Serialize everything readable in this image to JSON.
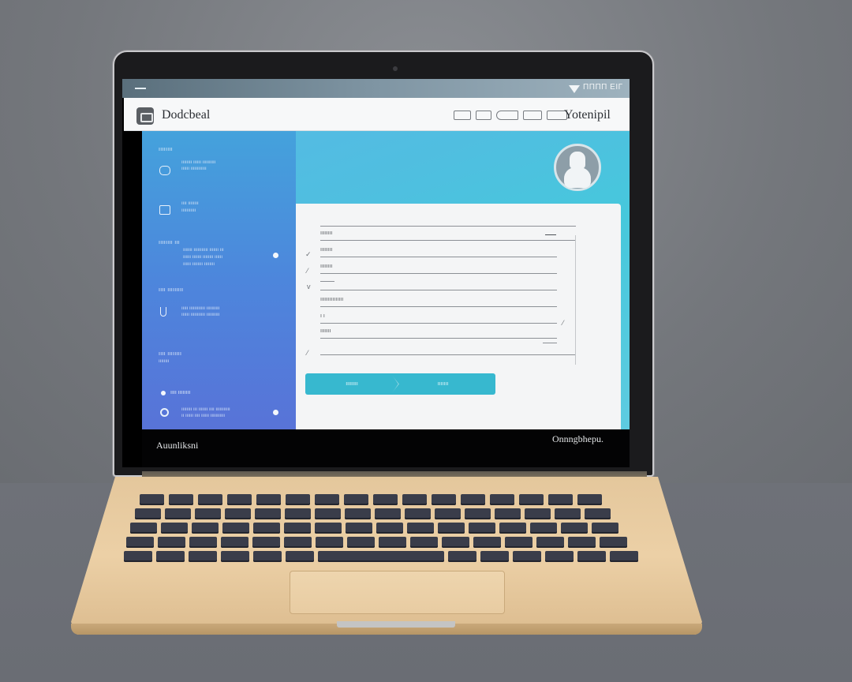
{
  "os_bar": {
    "status": "ΠΠΠΠ ΕΙΓ"
  },
  "header": {
    "title": "Dodcbeal",
    "user": "Yotenipil"
  },
  "sidebar": {
    "sections": [
      {
        "heading": "ıııııııı",
        "lines": [
          "ıııııııı ıııııı ıııııııııı",
          "ıııııı ıııııııııııı"
        ]
      },
      {
        "heading": "",
        "lines": [
          "ıııı ıııııııı",
          "ııııııııııı"
        ]
      },
      {
        "heading": "ıııııııı ııı",
        "lines": [
          "ııııııı ııııııııııı ııııııı ııı",
          "ıııııı ııııııı ıııııııı ıııııı",
          "ıııııı ıııııııı ıııııııı"
        ]
      },
      {
        "heading": "ıııı ııııııııı",
        "lines": [
          "ııııı ıııııııııııı ıııııııııı",
          "ıııııı ııııııııııı ıııııııııı"
        ]
      },
      {
        "heading": "ıııı ıııııııı",
        "lines": [
          "ıııııııı"
        ]
      },
      {
        "heading": "ıııı ıııııııı",
        "lines": []
      },
      {
        "heading": "",
        "lines": [
          "ıııııııı ııı ııııııı ıııı ııııııııııı",
          "ıı ıııııı ıııı ıııııı ııııııııııı"
        ]
      }
    ]
  },
  "form": {
    "fields": [
      {
        "label": "ıııııııı"
      },
      {
        "label": "ıııııııı"
      },
      {
        "label": "ıııııııı"
      },
      {
        "label": ""
      },
      {
        "label": "ııııııııııııııı"
      },
      {
        "label": "ı ı"
      },
      {
        "label": "ııııııı"
      },
      {
        "label": ""
      }
    ],
    "button_left": "ıııııııı",
    "button_right": "ııııııı"
  },
  "footer": {
    "left": "Auunliksni",
    "right": "Onnngbhepu."
  },
  "colors": {
    "accent": "#37b8cf",
    "sidebar_top": "#44a2dc",
    "sidebar_bottom": "#5873d8",
    "header_bg": "#f7f8f9",
    "laptop_body": "#e4c79c"
  },
  "icons": [
    "logo-icon",
    "hamburger-icon",
    "dropdown-triangle-icon",
    "shield-icon",
    "window-icon",
    "clipboard-icon",
    "ring-icon",
    "avatar-icon"
  ]
}
